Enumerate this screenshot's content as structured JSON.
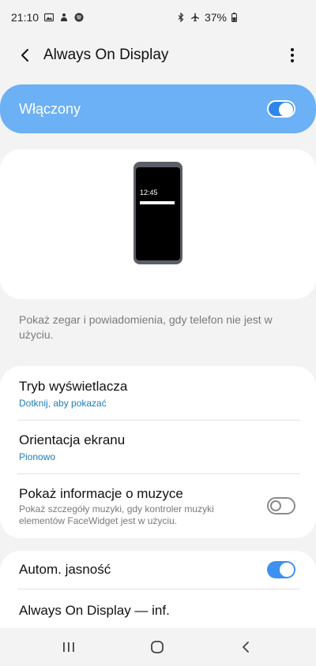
{
  "status_bar": {
    "time": "21:10",
    "battery_percent": "37%",
    "left_icons": [
      "image-icon",
      "notification-icon",
      "spotify-icon"
    ],
    "right_icons": [
      "bluetooth-icon",
      "airplane-icon",
      "battery-icon"
    ]
  },
  "app_bar": {
    "title": "Always On Display",
    "back_icon": "chevron-left-icon",
    "more_icon": "more-vert-icon"
  },
  "master_switch": {
    "label": "Włączony",
    "on": true
  },
  "preview": {
    "time": "12:45"
  },
  "description": "Pokaż zegar i powiadomienia, gdy telefon nie jest w użyciu.",
  "settings": [
    {
      "title": "Tryb wyświetlacza",
      "subtitle": "Dotknij, aby pokazać"
    },
    {
      "title": "Orientacja ekranu",
      "subtitle": "Pionowo"
    },
    {
      "title": "Pokaż informacje o muzyce",
      "subtitle": "Pokaż szczegóły muzyki, gdy kontroler muzyki elementów FaceWidget jest w użyciu.",
      "on": false
    }
  ],
  "settings2": [
    {
      "title": "Autom. jasność",
      "on": true
    },
    {
      "title": "Always On Display — inf."
    }
  ],
  "nav": {
    "recents_icon": "recents-icon",
    "home_icon": "home-icon",
    "back_icon": "back-icon"
  },
  "colors": {
    "accent": "#3e91f0",
    "master_bg": "#6cb0f5",
    "link": "#1e7cb8"
  }
}
